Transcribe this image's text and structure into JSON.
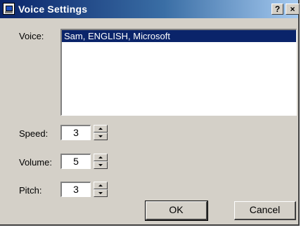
{
  "window": {
    "title": "Voice Settings",
    "help_label": "?",
    "close_label": "×"
  },
  "voice": {
    "label": "Voice:",
    "items": [
      "Sam, ENGLISH, Microsoft"
    ],
    "selected_index": 0
  },
  "speed": {
    "label": "Speed:",
    "value": "3"
  },
  "volume": {
    "label": "Volume:",
    "value": "5"
  },
  "pitch": {
    "label": "Pitch:",
    "value": "3"
  },
  "buttons": {
    "ok": "OK",
    "cancel": "Cancel"
  },
  "colors": {
    "titlebar": "#0a246a",
    "selection": "#0a246a",
    "face": "#d4d0c8"
  },
  "icons": {
    "app": "speech-app-icon"
  }
}
